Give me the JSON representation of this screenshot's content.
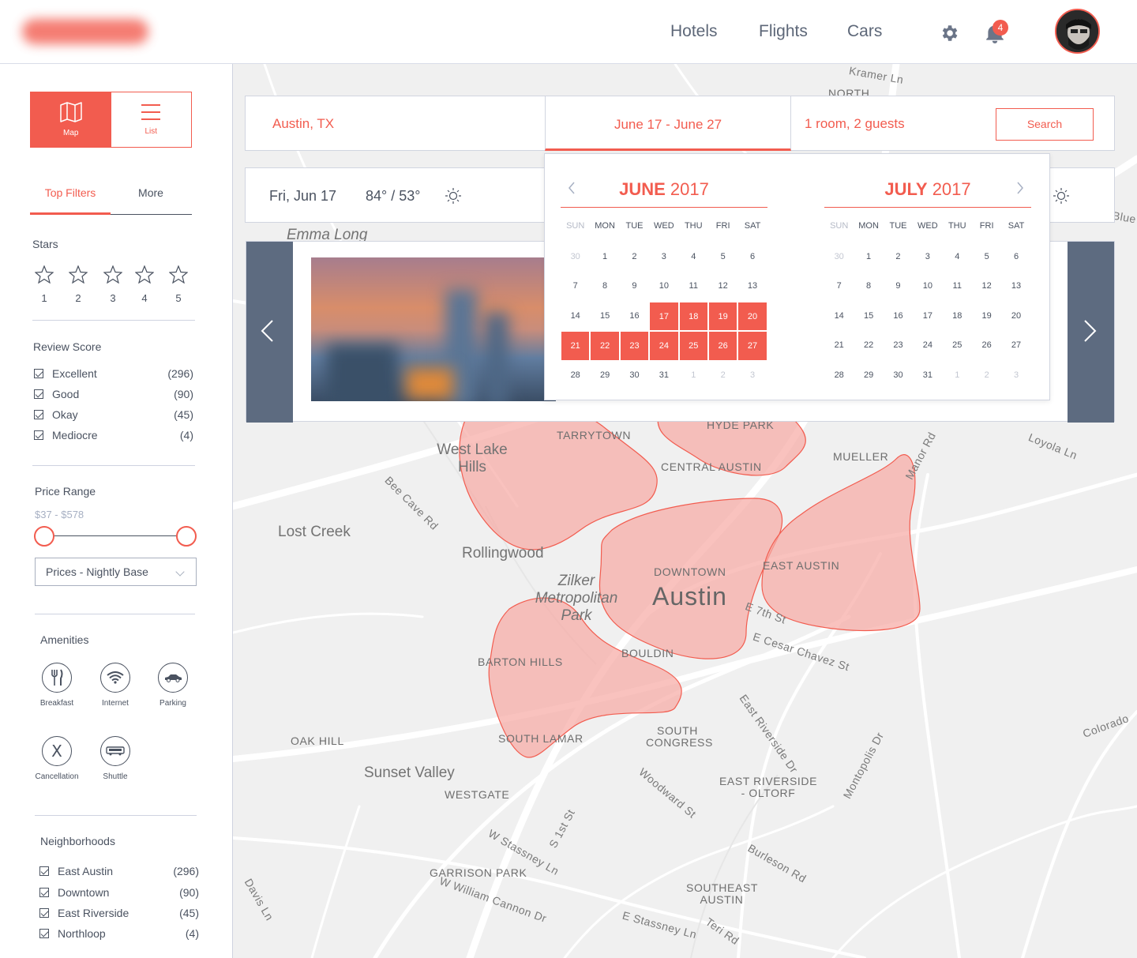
{
  "header": {
    "nav": [
      "Hotels",
      "Flights",
      "Cars"
    ],
    "notification_count": "4"
  },
  "sidebar": {
    "view_toggle": {
      "map_label": "Map",
      "list_label": "List"
    },
    "filter_tabs": [
      "Top Filters",
      "More"
    ],
    "stars": {
      "title": "Stars",
      "values": [
        "1",
        "2",
        "3",
        "4",
        "5"
      ]
    },
    "review_score": {
      "title": "Review Score",
      "items": [
        {
          "label": "Excellent",
          "count": "(296)"
        },
        {
          "label": "Good",
          "count": "(90)"
        },
        {
          "label": "Okay",
          "count": "(45)"
        },
        {
          "label": "Mediocre",
          "count": "(4)"
        }
      ]
    },
    "price": {
      "title": "Price Range",
      "range": "$37 -  $578",
      "dropdown": "Prices - Nightly Base"
    },
    "amenities": {
      "title": "Amenities",
      "items": [
        {
          "label": "Breakfast",
          "icon": "fork-knife-icon"
        },
        {
          "label": "Internet",
          "icon": "wifi-icon"
        },
        {
          "label": "Parking",
          "icon": "car-icon"
        },
        {
          "label": "Cancellation",
          "icon": "x-icon"
        },
        {
          "label": "Shuttle",
          "icon": "bus-icon"
        }
      ]
    },
    "neighborhoods": {
      "title": "Neighborhoods",
      "items": [
        {
          "label": "East Austin",
          "count": "(296)"
        },
        {
          "label": "Downtown",
          "count": "(90)"
        },
        {
          "label": "East Riverside",
          "count": "(45)"
        },
        {
          "label": "Northloop",
          "count": "(4)"
        }
      ]
    }
  },
  "search": {
    "location": "Austin, TX",
    "dates": "June 17  -  June 27",
    "guests": "1 room, 2 guests",
    "button": "Search"
  },
  "weather": {
    "date": "Fri, Jun 17",
    "temp": "84° / 53°"
  },
  "calendar": {
    "dows": [
      "SUN",
      "MON",
      "TUE",
      "WED",
      "THU",
      "FRI",
      "SAT"
    ],
    "months": [
      {
        "name": "JUNE",
        "year": "2017",
        "weeks": [
          [
            "30",
            "1",
            "2",
            "3",
            "4",
            "5",
            "6"
          ],
          [
            "7",
            "8",
            "9",
            "10",
            "11",
            "12",
            "13"
          ],
          [
            "14",
            "15",
            "16",
            "17",
            "18",
            "19",
            "20"
          ],
          [
            "21",
            "22",
            "23",
            "24",
            "25",
            "26",
            "27"
          ],
          [
            "28",
            "29",
            "30",
            "31",
            "1",
            "2",
            "3"
          ]
        ]
      },
      {
        "name": "JULY",
        "year": "2017",
        "weeks": [
          [
            "30",
            "1",
            "2",
            "3",
            "4",
            "5",
            "6"
          ],
          [
            "7",
            "8",
            "9",
            "10",
            "11",
            "12",
            "13"
          ],
          [
            "14",
            "15",
            "16",
            "17",
            "18",
            "19",
            "20"
          ],
          [
            "21",
            "22",
            "23",
            "24",
            "25",
            "26",
            "27"
          ],
          [
            "28",
            "29",
            "30",
            "31",
            "1",
            "2",
            "3"
          ]
        ]
      }
    ],
    "selected_range": [
      "17",
      "27"
    ]
  },
  "map": {
    "labels": [
      "NORTH",
      "Emma Long",
      "West Lake Hills",
      "TARRYTOWN",
      "HYDE PARK",
      "CENTRAL AUSTIN",
      "MUELLER",
      "Lost Creek",
      "Rollingwood",
      "DOWNTOWN",
      "Austin",
      "EAST AUSTIN",
      "Zilker Metropolitan Park",
      "BOULDIN",
      "BARTON HILLS",
      "SOUTH LAMAR",
      "SOUTH CONGRESS",
      "OAK HILL",
      "Sunset Valley",
      "WESTGATE",
      "EAST RIVERSIDE - OLTORF",
      "GARRISON PARK",
      "SOUTHEAST AUSTIN",
      "Kramer Ln",
      "Bee Cave Rd",
      "Loyola Ln",
      "Manor Rd",
      "E 7th St",
      "E Cesar Chavez St",
      "East Riverside Dr",
      "Montopolis Dr",
      "Colorado",
      "Woodward St",
      "S 1st St",
      "W Stassney Ln",
      "Burleson Rd",
      "W William Cannon Dr",
      "E Stassney Ln",
      "Teri Rd",
      "Davis Ln",
      "Blue",
      "Loyola Ln"
    ]
  },
  "colors": {
    "accent": "#f25c4f",
    "dark": "#4a5260",
    "slate": "#5d6b80"
  }
}
